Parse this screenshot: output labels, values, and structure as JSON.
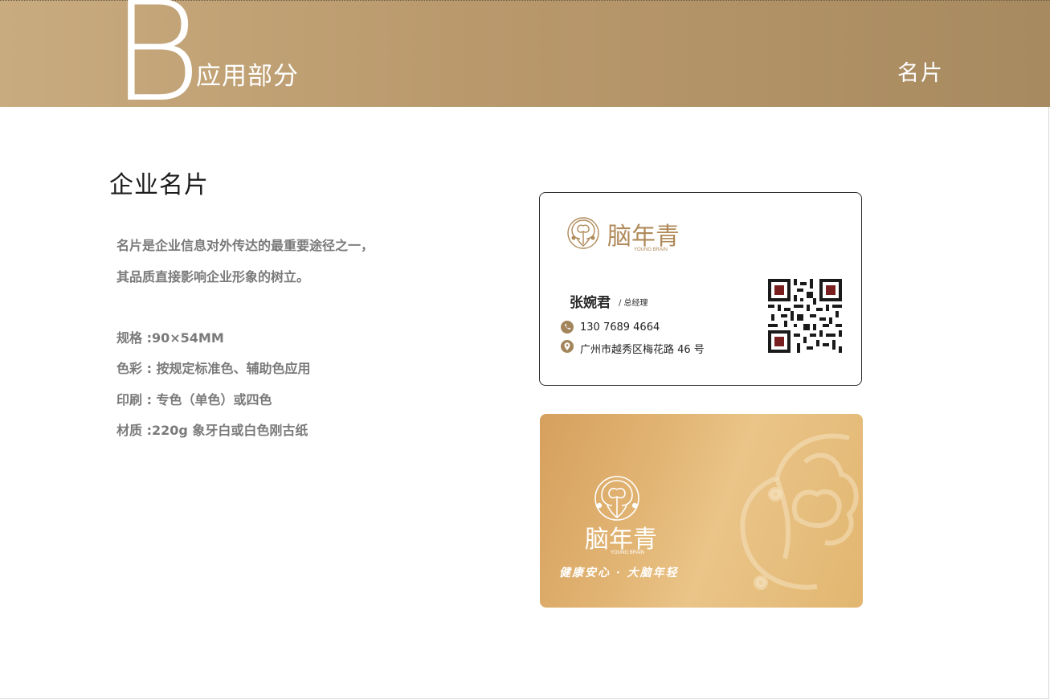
{
  "header": {
    "letter": "B",
    "section_title": "应用部分",
    "right_label": "名片"
  },
  "content": {
    "heading": "企业名片",
    "intro_lines": [
      "名片是企业信息对外传达的最重要途径之一，",
      "其品质直接影响企业形象的树立。"
    ],
    "specs": [
      "规格 :90×54MM",
      "色彩 : 按规定标准色、辅助色应用",
      "印刷 : 专色（单色）或四色",
      "材质 :220g 象牙白或白色刚古纸"
    ]
  },
  "card_front": {
    "brand_name": "脑年青",
    "brand_en": "YOUNG BRAIN",
    "person_name": "张婉君",
    "person_title": "/ 总经理",
    "phone": "130 7689 4664",
    "address": "广州市越秀区梅花路 46 号",
    "icons": {
      "phone": "phone-icon",
      "location": "location-pin-icon"
    },
    "accent_color": "#b08a5a"
  },
  "card_back": {
    "brand_name": "脑年青",
    "brand_en": "YOUNG BRAIN",
    "slogan": "健康安心 · 大脑年轻",
    "gradient_colors": [
      "#d6a05e",
      "#eac488",
      "#e2b66f"
    ]
  },
  "colors": {
    "header_gold": "#b9996c",
    "body_text_gray": "#7a7a7a",
    "heading_text": "#1c1c1c"
  }
}
